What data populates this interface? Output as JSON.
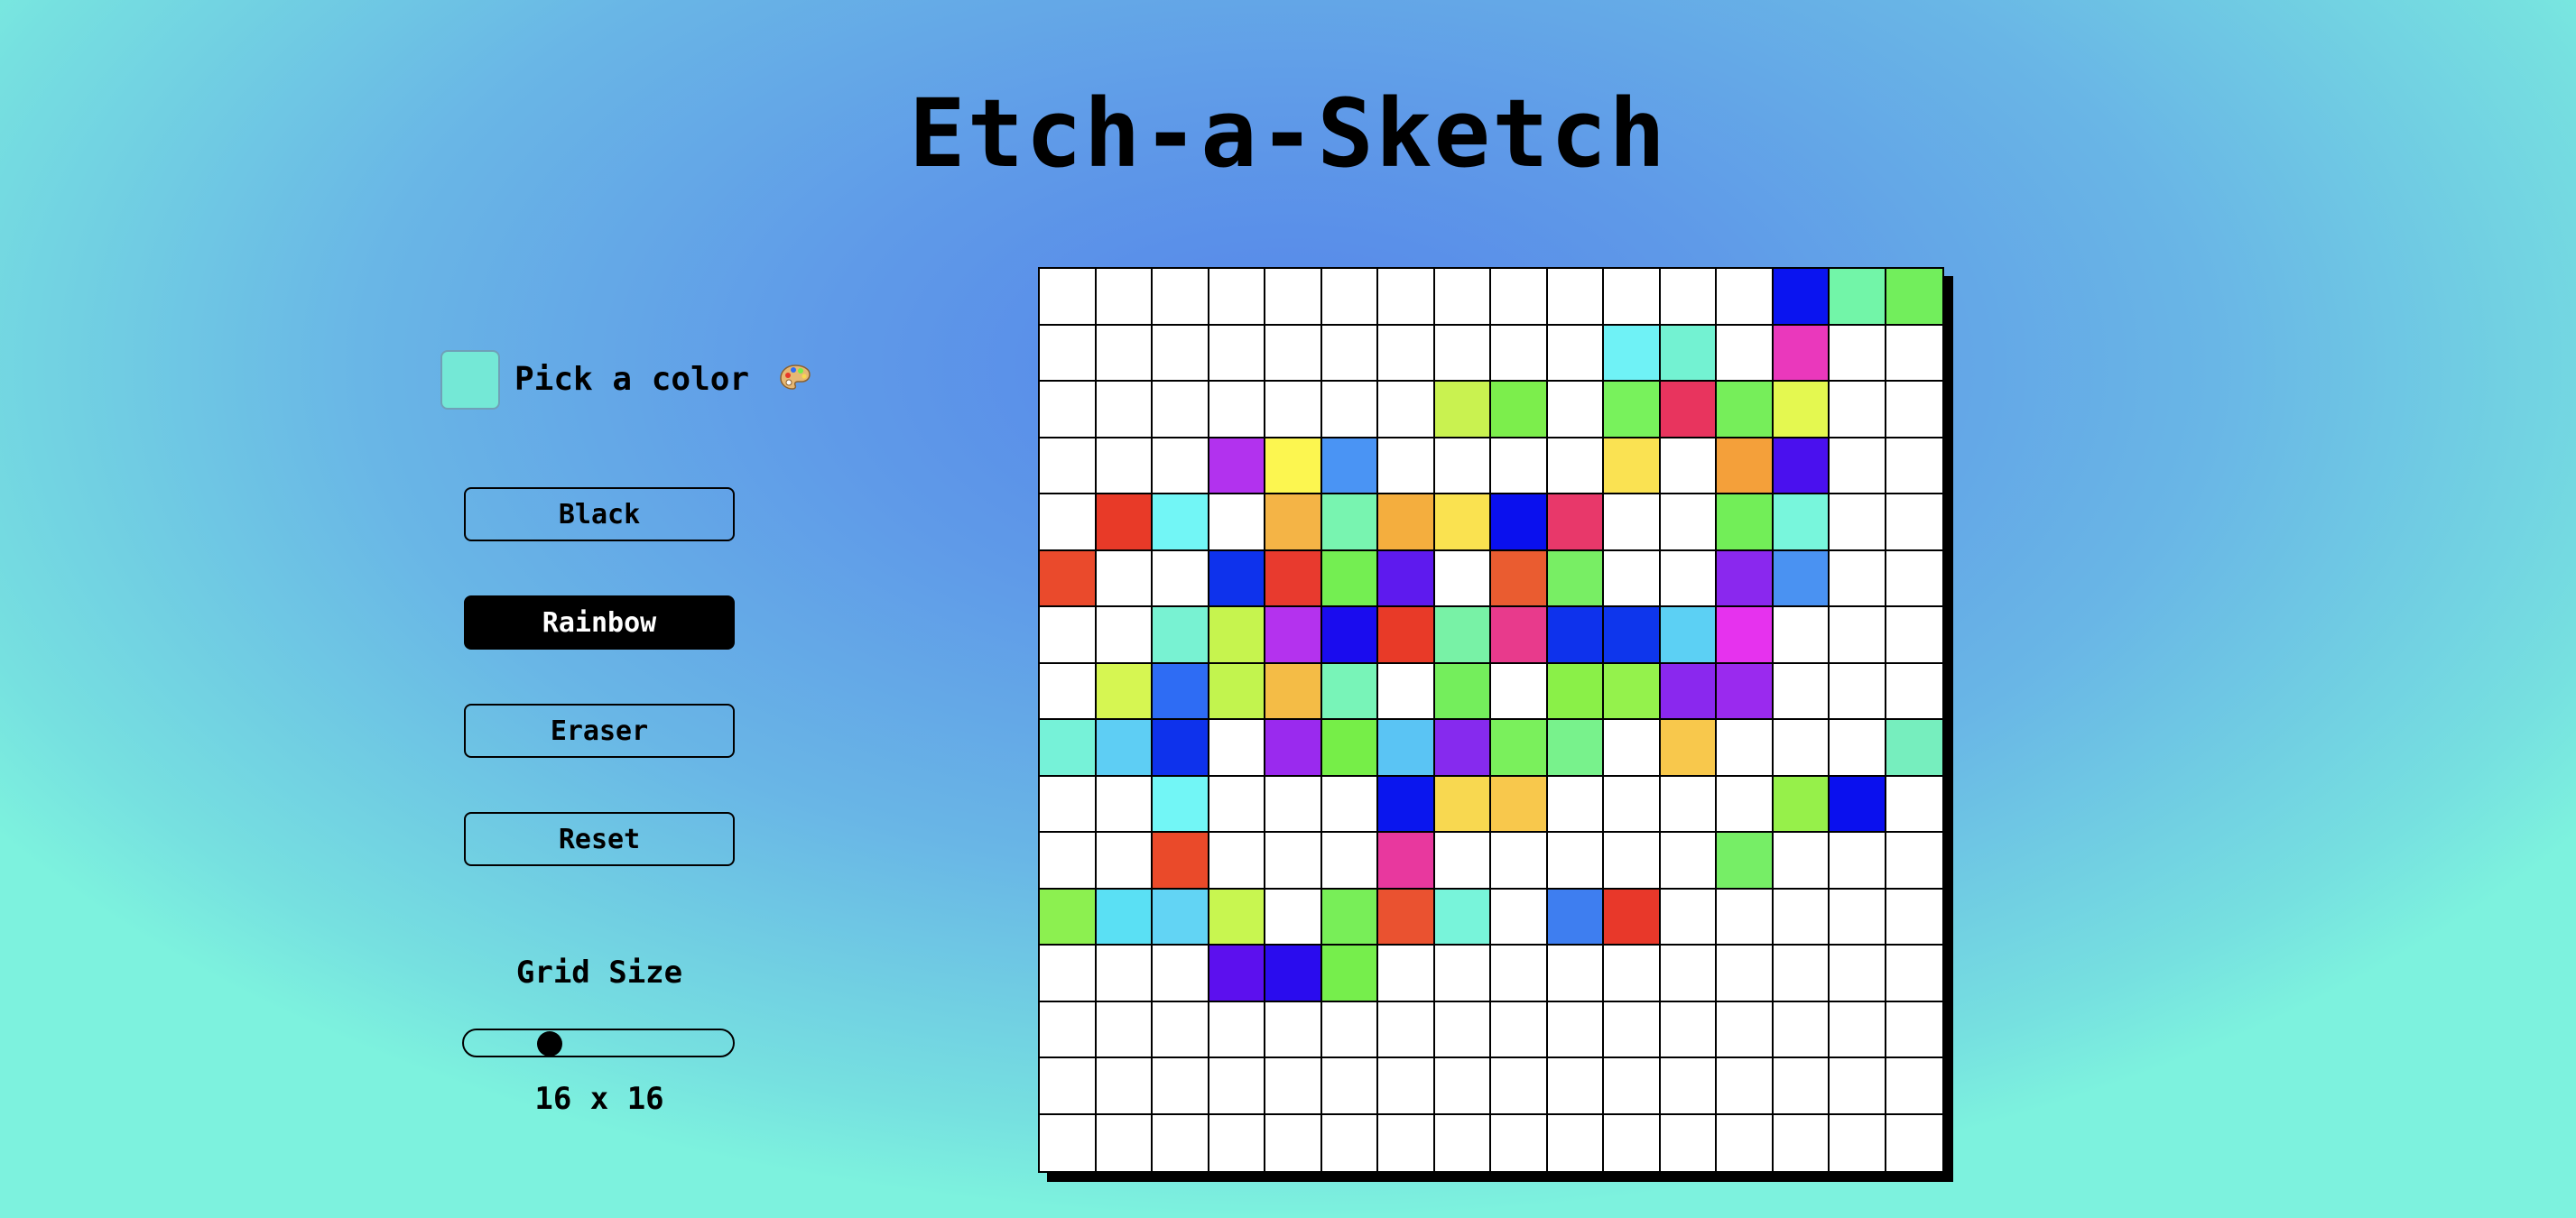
{
  "title": "Etch-a-Sketch",
  "color_picker": {
    "label": "Pick a color",
    "icon": "palette-icon",
    "value": "#74e8d6"
  },
  "buttons": [
    {
      "key": "black",
      "label": "Black",
      "active": false
    },
    {
      "key": "rainbow",
      "label": "Rainbow",
      "active": true
    },
    {
      "key": "eraser",
      "label": "Eraser",
      "active": false
    },
    {
      "key": "reset",
      "label": "Reset",
      "active": false
    }
  ],
  "grid_size": {
    "label": "Grid Size",
    "value": 16,
    "min": 1,
    "max": 64,
    "display": "16 x 16"
  },
  "board": {
    "rows": 16,
    "cols": 16,
    "cells": [
      [
        "",
        "",
        "",
        "",
        "",
        "",
        "",
        "",
        "",
        "",
        "",
        "",
        "",
        "#0a14f0",
        "#72f5a8",
        "#72ee5c"
      ],
      [
        "",
        "",
        "",
        "",
        "",
        "",
        "",
        "",
        "",
        "",
        "#6ff2f6",
        "#73f2d2",
        "",
        "#ea38bc",
        "",
        ""
      ],
      [
        "",
        "",
        "",
        "",
        "",
        "",
        "",
        "#c9f250",
        "#7cee4c",
        "",
        "#78f25c",
        "#e8345e",
        "#76ee5a",
        "#e4f850",
        "",
        ""
      ],
      [
        "",
        "",
        "",
        "#b232ee",
        "#fcf650",
        "#4a94f4",
        "",
        "",
        "",
        "",
        "#fae252",
        "",
        "#f4a03a",
        "#4a10ee",
        "",
        ""
      ],
      [
        "",
        "#e83a28",
        "#72f6f6",
        "",
        "#f4b446",
        "#78f4b0",
        "#f4ae3e",
        "#fae250",
        "#0a10ee",
        "#e8386a",
        "",
        "",
        "#72ee58",
        "#78f6dc",
        "",
        ""
      ],
      [
        "#ea4a2c",
        "",
        "",
        "#0e32ec",
        "#e83a2e",
        "#74ee52",
        "#5e1aee",
        "",
        "#ea5c30",
        "#78ee64",
        "",
        "",
        "#8a28ee",
        "#4a92f2",
        "",
        ""
      ],
      [
        "",
        "",
        "#78f2d2",
        "#c6f44e",
        "#b432ee",
        "#1a0cee",
        "#e83a28",
        "#78f2a6",
        "#e83a8c",
        "#0e32ec",
        "#0e36ec",
        "#5cd0f4",
        "#e632ee",
        "",
        "",
        ""
      ],
      [
        "",
        "#d6f652",
        "#2e6cf4",
        "#c2f44e",
        "#f4bc46",
        "#78f4b8",
        "",
        "#74ee5c",
        "",
        "#8af048",
        "#94f24c",
        "#8a28ee",
        "#9a2aee",
        "",
        "",
        ""
      ],
      [
        "#76f2d8",
        "#5ecef4",
        "#0e32ec",
        "",
        "#9a2aee",
        "#76ee48",
        "#5ac4f4",
        "#862aee",
        "#7af05c",
        "#78f28c",
        "",
        "#f8c84c",
        "",
        "",
        "",
        "#76eebe"
      ],
      [
        "",
        "",
        "#72f6f6",
        "",
        "",
        "",
        "#0a16ee",
        "#f8d850",
        "#f8c84c",
        "",
        "",
        "",
        "",
        "#96f04a",
        "#0a10ee",
        ""
      ],
      [
        "",
        "",
        "#ea4a2a",
        "",
        "",
        "",
        "#e8389e",
        "",
        "",
        "",
        "",
        "",
        "#76ee66",
        "",
        "",
        ""
      ],
      [
        "#8cf050",
        "#5ae0f4",
        "#62d4f4",
        "#c8f650",
        "",
        "#78ee58",
        "#ea5230",
        "#78f4da",
        "",
        "#3e7ef0",
        "#e8382a",
        "",
        "",
        "",
        "",
        ""
      ],
      [
        "",
        "",
        "",
        "#5c10ee",
        "#2a0cee",
        "#76ee4c",
        "",
        "",
        "",
        "",
        "",
        "",
        "",
        "",
        "",
        ""
      ],
      [
        "",
        "",
        "",
        "",
        "",
        "",
        "",
        "",
        "",
        "",
        "",
        "",
        "",
        "",
        "",
        ""
      ],
      [
        "",
        "",
        "",
        "",
        "",
        "",
        "",
        "",
        "",
        "",
        "",
        "",
        "",
        "",
        "",
        ""
      ],
      [
        "",
        "",
        "",
        "",
        "",
        "",
        "",
        "",
        "",
        "",
        "",
        "",
        "",
        "",
        "",
        ""
      ]
    ]
  }
}
